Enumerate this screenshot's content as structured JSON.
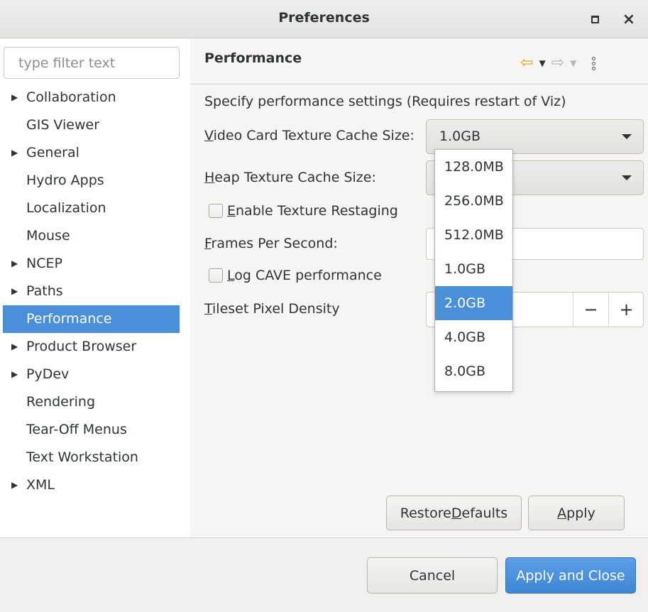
{
  "window": {
    "title": "Preferences"
  },
  "sidebar": {
    "filter_placeholder": "type filter text",
    "items": [
      {
        "label": "Collaboration",
        "expandable": true
      },
      {
        "label": "GIS Viewer",
        "expandable": false
      },
      {
        "label": "General",
        "expandable": true
      },
      {
        "label": "Hydro Apps",
        "expandable": false
      },
      {
        "label": "Localization",
        "expandable": false
      },
      {
        "label": "Mouse",
        "expandable": false
      },
      {
        "label": "NCEP",
        "expandable": true
      },
      {
        "label": "Paths",
        "expandable": true
      },
      {
        "label": "Performance",
        "expandable": false,
        "selected": true
      },
      {
        "label": "Product Browser",
        "expandable": true
      },
      {
        "label": "PyDev",
        "expandable": true
      },
      {
        "label": "Rendering",
        "expandable": false
      },
      {
        "label": "Tear-Off Menus",
        "expandable": false
      },
      {
        "label": "Text Workstation",
        "expandable": false
      },
      {
        "label": "XML",
        "expandable": true
      }
    ]
  },
  "page": {
    "title": "Performance",
    "description": "Specify performance settings (Requires restart of Viz)",
    "video_card_label_mn": "V",
    "video_card_label_rest": "ideo Card Texture Cache Size:",
    "video_card_value": "1.0GB",
    "heap_label_mn": "H",
    "heap_label_rest": "eap Texture Cache Size:",
    "restaging_label_mn": "E",
    "restaging_label_rest": "nable Texture Restaging",
    "fps_label_mn": "F",
    "fps_label_rest": "rames Per Second:",
    "log_cave_label_mn": "L",
    "log_cave_label_rest": "og CAVE performance",
    "tileset_label_mn": "T",
    "tileset_label_rest": "ileset Pixel Density",
    "spinner_minus": "−",
    "spinner_plus": "+",
    "restore_label_pre": "Restore ",
    "restore_label_mn": "D",
    "restore_label_post": "efaults",
    "apply_label_mn": "A",
    "apply_label_rest": "pply"
  },
  "dropdown": {
    "options": [
      "128.0MB",
      "256.0MB",
      "512.0MB",
      "1.0GB",
      "2.0GB",
      "4.0GB",
      "8.0GB"
    ],
    "highlighted": "2.0GB"
  },
  "footer": {
    "cancel_label": "Cancel",
    "apply_close_label": "Apply and Close"
  },
  "colors": {
    "selection": "#4a90d9",
    "nav_back_icon": "#e2a51c"
  }
}
